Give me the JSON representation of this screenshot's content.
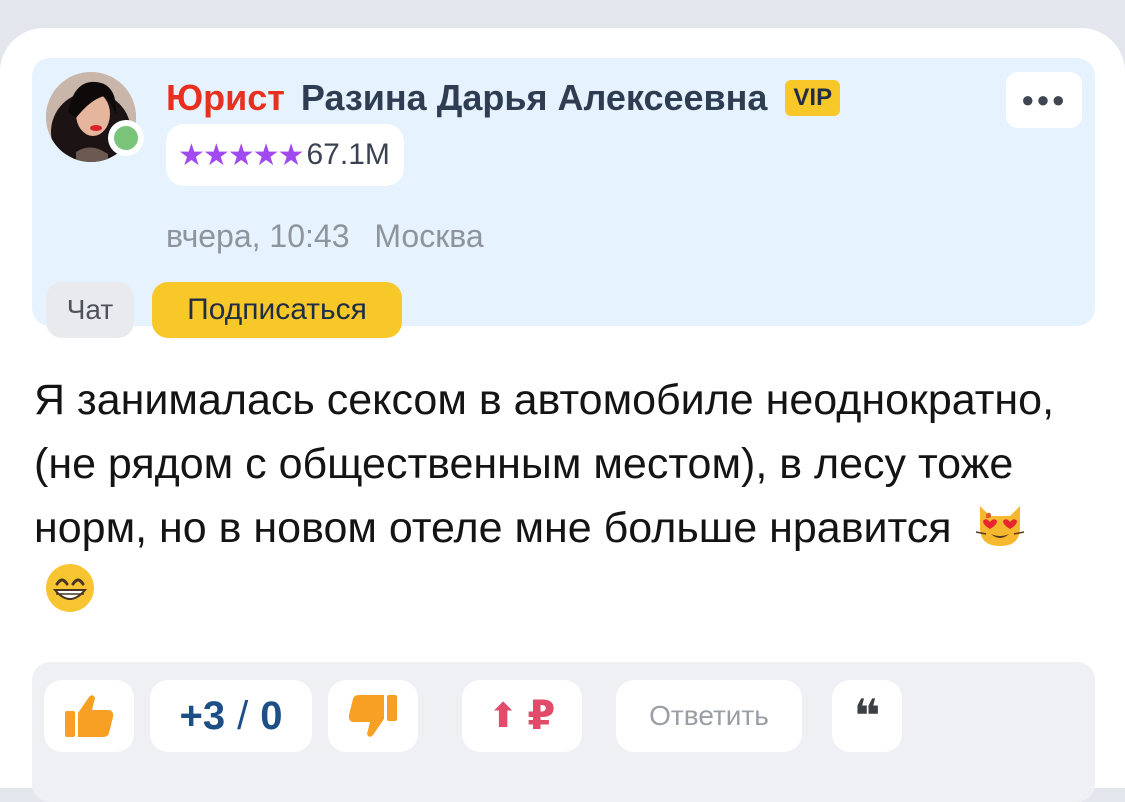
{
  "author": {
    "role": "Юрист",
    "name": "Разина Дарья Алексеевна",
    "badge": "VIP",
    "stars": "★★★★★",
    "rating": "67.1M",
    "time": "вчера, 10:43",
    "city": "Москва",
    "online": true
  },
  "header_actions": {
    "more_icon": "ellipsis-icon",
    "chat_label": "Чат",
    "subscribe_label": "Подписаться"
  },
  "message": {
    "text": "Я занималась сексом в автомобиле неоднократно, (не рядом с общественным местом), в лесу тоже норм, но в новом отеле мне больше нравится",
    "emojis": [
      "heart-eyes-cat-emoji",
      "grinning-face-emoji"
    ]
  },
  "actions": {
    "like_icon": "thumbs-up-icon",
    "likes": "+3",
    "separator": "/",
    "dislikes": "0",
    "dislike_icon": "thumbs-down-icon",
    "raise_arrow": "⬆",
    "raise_currency": "₽",
    "reply_label": "Ответить",
    "quote_icon": "quote-icon"
  },
  "colors": {
    "role": "#e8301e",
    "accent_yellow": "#f8c728",
    "like_orange": "#f7a023",
    "header_bg": "#e6f2fd",
    "rating_stars": "#a04af0"
  }
}
